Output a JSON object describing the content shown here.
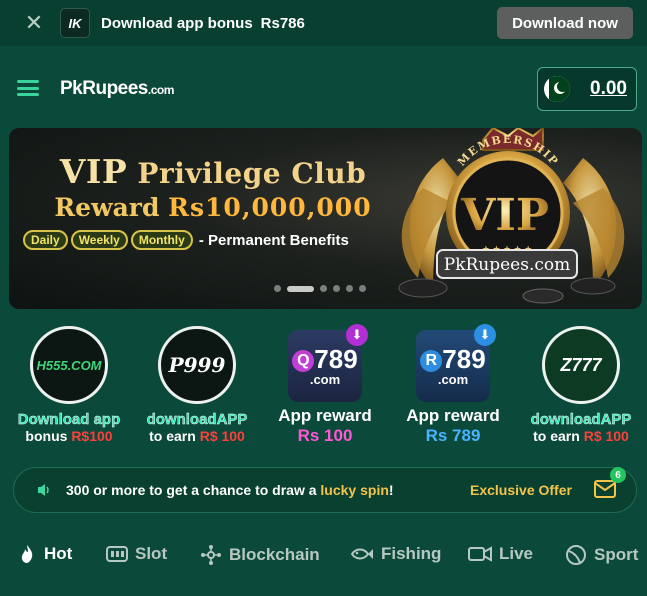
{
  "topbar": {
    "app_logo": "IK",
    "bonus_text": "Download app bonus",
    "bonus_amount": "Rs786",
    "download_button": "Download now"
  },
  "header": {
    "brand_main": "PkRupees",
    "brand_suffix": ".com",
    "balance": "0.00"
  },
  "banner": {
    "title_vip": "VIP",
    "title_rest": "Privilege Club",
    "reward_label": "Reward",
    "reward_amount": "Rs10,000,000",
    "pills": [
      "Daily",
      "Weekly",
      "Monthly"
    ],
    "benefit_text": "- Permanent Benefits",
    "badge_arc": "MEMBERSHIP",
    "badge_vip": "VIP",
    "badge_ribbon": "PkRupees.com",
    "active_slide": 1,
    "slide_count": 6
  },
  "apps": [
    {
      "logo": "H555.COM",
      "line1": "Download app",
      "line2_prefix": "bonus ",
      "line2_highlight": "R$100"
    },
    {
      "logo": "P999",
      "line1": "downloadAPP",
      "line2_prefix": "to earn ",
      "line2_highlight": "R$ 100"
    },
    {
      "logo_main": "789",
      "logo_letter": "Q",
      "logo_sub": ".com",
      "line1": "App reward",
      "line2": "Rs 100"
    },
    {
      "logo_main": "789",
      "logo_letter": "R",
      "logo_sub": ".com",
      "line1": "App reward",
      "line2": "Rs 789"
    },
    {
      "logo": "Z777",
      "line1": "downloadAPP",
      "line2_prefix": "to earn ",
      "line2_highlight": "R$ 100"
    }
  ],
  "marquee": {
    "text_before": "300 or more to get a chance to draw a ",
    "text_highlight": "lucky spin",
    "text_after": "!",
    "exclusive": "Exclusive Offer",
    "mail_count": "6"
  },
  "tabs": [
    "Hot",
    "Slot",
    "Blockchain",
    "Fishing",
    "Live",
    "Sport"
  ],
  "colors": {
    "background": "#0b4a3a",
    "accent_green": "#39d39c",
    "gold": "#f3c44b"
  }
}
